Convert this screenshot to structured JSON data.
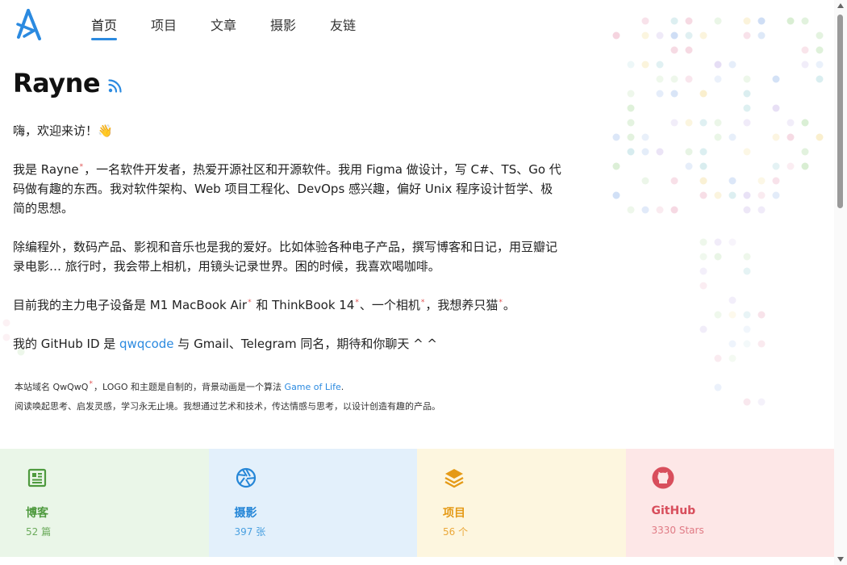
{
  "nav": {
    "items": [
      {
        "label": "首页",
        "active": true
      },
      {
        "label": "项目"
      },
      {
        "label": "文章"
      },
      {
        "label": "摄影"
      },
      {
        "label": "友链"
      }
    ]
  },
  "profile": {
    "name": "Rayne",
    "greeting": "嗨，欢迎来访！",
    "wave_emoji": "👋",
    "para1": {
      "prefix": "我是 Rayne",
      "suffix": "，一名软件开发者，热爱开源社区和开源软件。我用 Figma 做设计，写 C#、TS、Go 代码做有趣的东西。我对软件架构、Web 项目工程化、DevOps 感兴趣，偏好 Unix 程序设计哲学、极简的思想。"
    },
    "para2": "除编程外，数码产品、影视和音乐也是我的爱好。比如体验各种电子产品，撰写博客和日记，用豆瓣记录电影… 旅行时，我会带上相机，用镜头记录世界。困的时候，我喜欢喝咖啡。",
    "para3": {
      "p1": "目前我的主力电子设备是 M1 MacBook Air",
      "p2": " 和 ThinkBook 14",
      "p3": "、一个相机",
      "p4": "，我想养只猫",
      "p5": "。"
    },
    "para4": {
      "prefix": "我的 GitHub ID 是 ",
      "link": "qwqcode",
      "suffix": " 与 Gmail、Telegram 同名，期待和你聊天 ^ ^"
    },
    "note1": {
      "prefix": "本站域名 QwQwQ",
      "middle": "，LOGO 和主题是自制的，背景动画是一个算法 ",
      "link": "Game of Life",
      "end": "."
    },
    "note2": "阅读唤起思考、启发灵感，学习永无止境。我想通过艺术和技术，传达情感与思考，以设计创造有趣的产品。",
    "footnote_mark": "*"
  },
  "cards": [
    {
      "label": "博客",
      "count": "52 篇",
      "icon": "newspaper-icon",
      "color": "#4e9a3e"
    },
    {
      "label": "摄影",
      "count": "397 张",
      "icon": "aperture-icon",
      "color": "#2586d7"
    },
    {
      "label": "项目",
      "count": "56 个",
      "icon": "layers-icon",
      "color": "#e59a16"
    },
    {
      "label": "GitHub",
      "count": "3330 Stars",
      "icon": "github-icon",
      "color": "#d84e5c"
    }
  ],
  "colors": {
    "accent": "#2b8ae0"
  }
}
